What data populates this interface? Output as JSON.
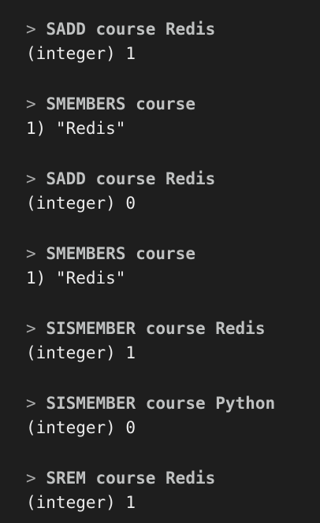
{
  "terminal": {
    "entries": [
      {
        "prompt": ">",
        "command": "SADD course Redis",
        "output": "(integer) 1"
      },
      {
        "prompt": ">",
        "command": "SMEMBERS course",
        "output": "1) \"Redis\""
      },
      {
        "prompt": ">",
        "command": "SADD course Redis",
        "output": "(integer) 0"
      },
      {
        "prompt": ">",
        "command": "SMEMBERS course",
        "output": "1) \"Redis\""
      },
      {
        "prompt": ">",
        "command": "SISMEMBER course Redis",
        "output": "(integer) 1"
      },
      {
        "prompt": ">",
        "command": "SISMEMBER course Python",
        "output": "(integer) 0"
      },
      {
        "prompt": ">",
        "command": "SREM course Redis",
        "output": "(integer) 1"
      }
    ]
  },
  "colors": {
    "background": "#1e1e1e",
    "command_text": "#cfd0d0",
    "output_text": "#ececec"
  }
}
